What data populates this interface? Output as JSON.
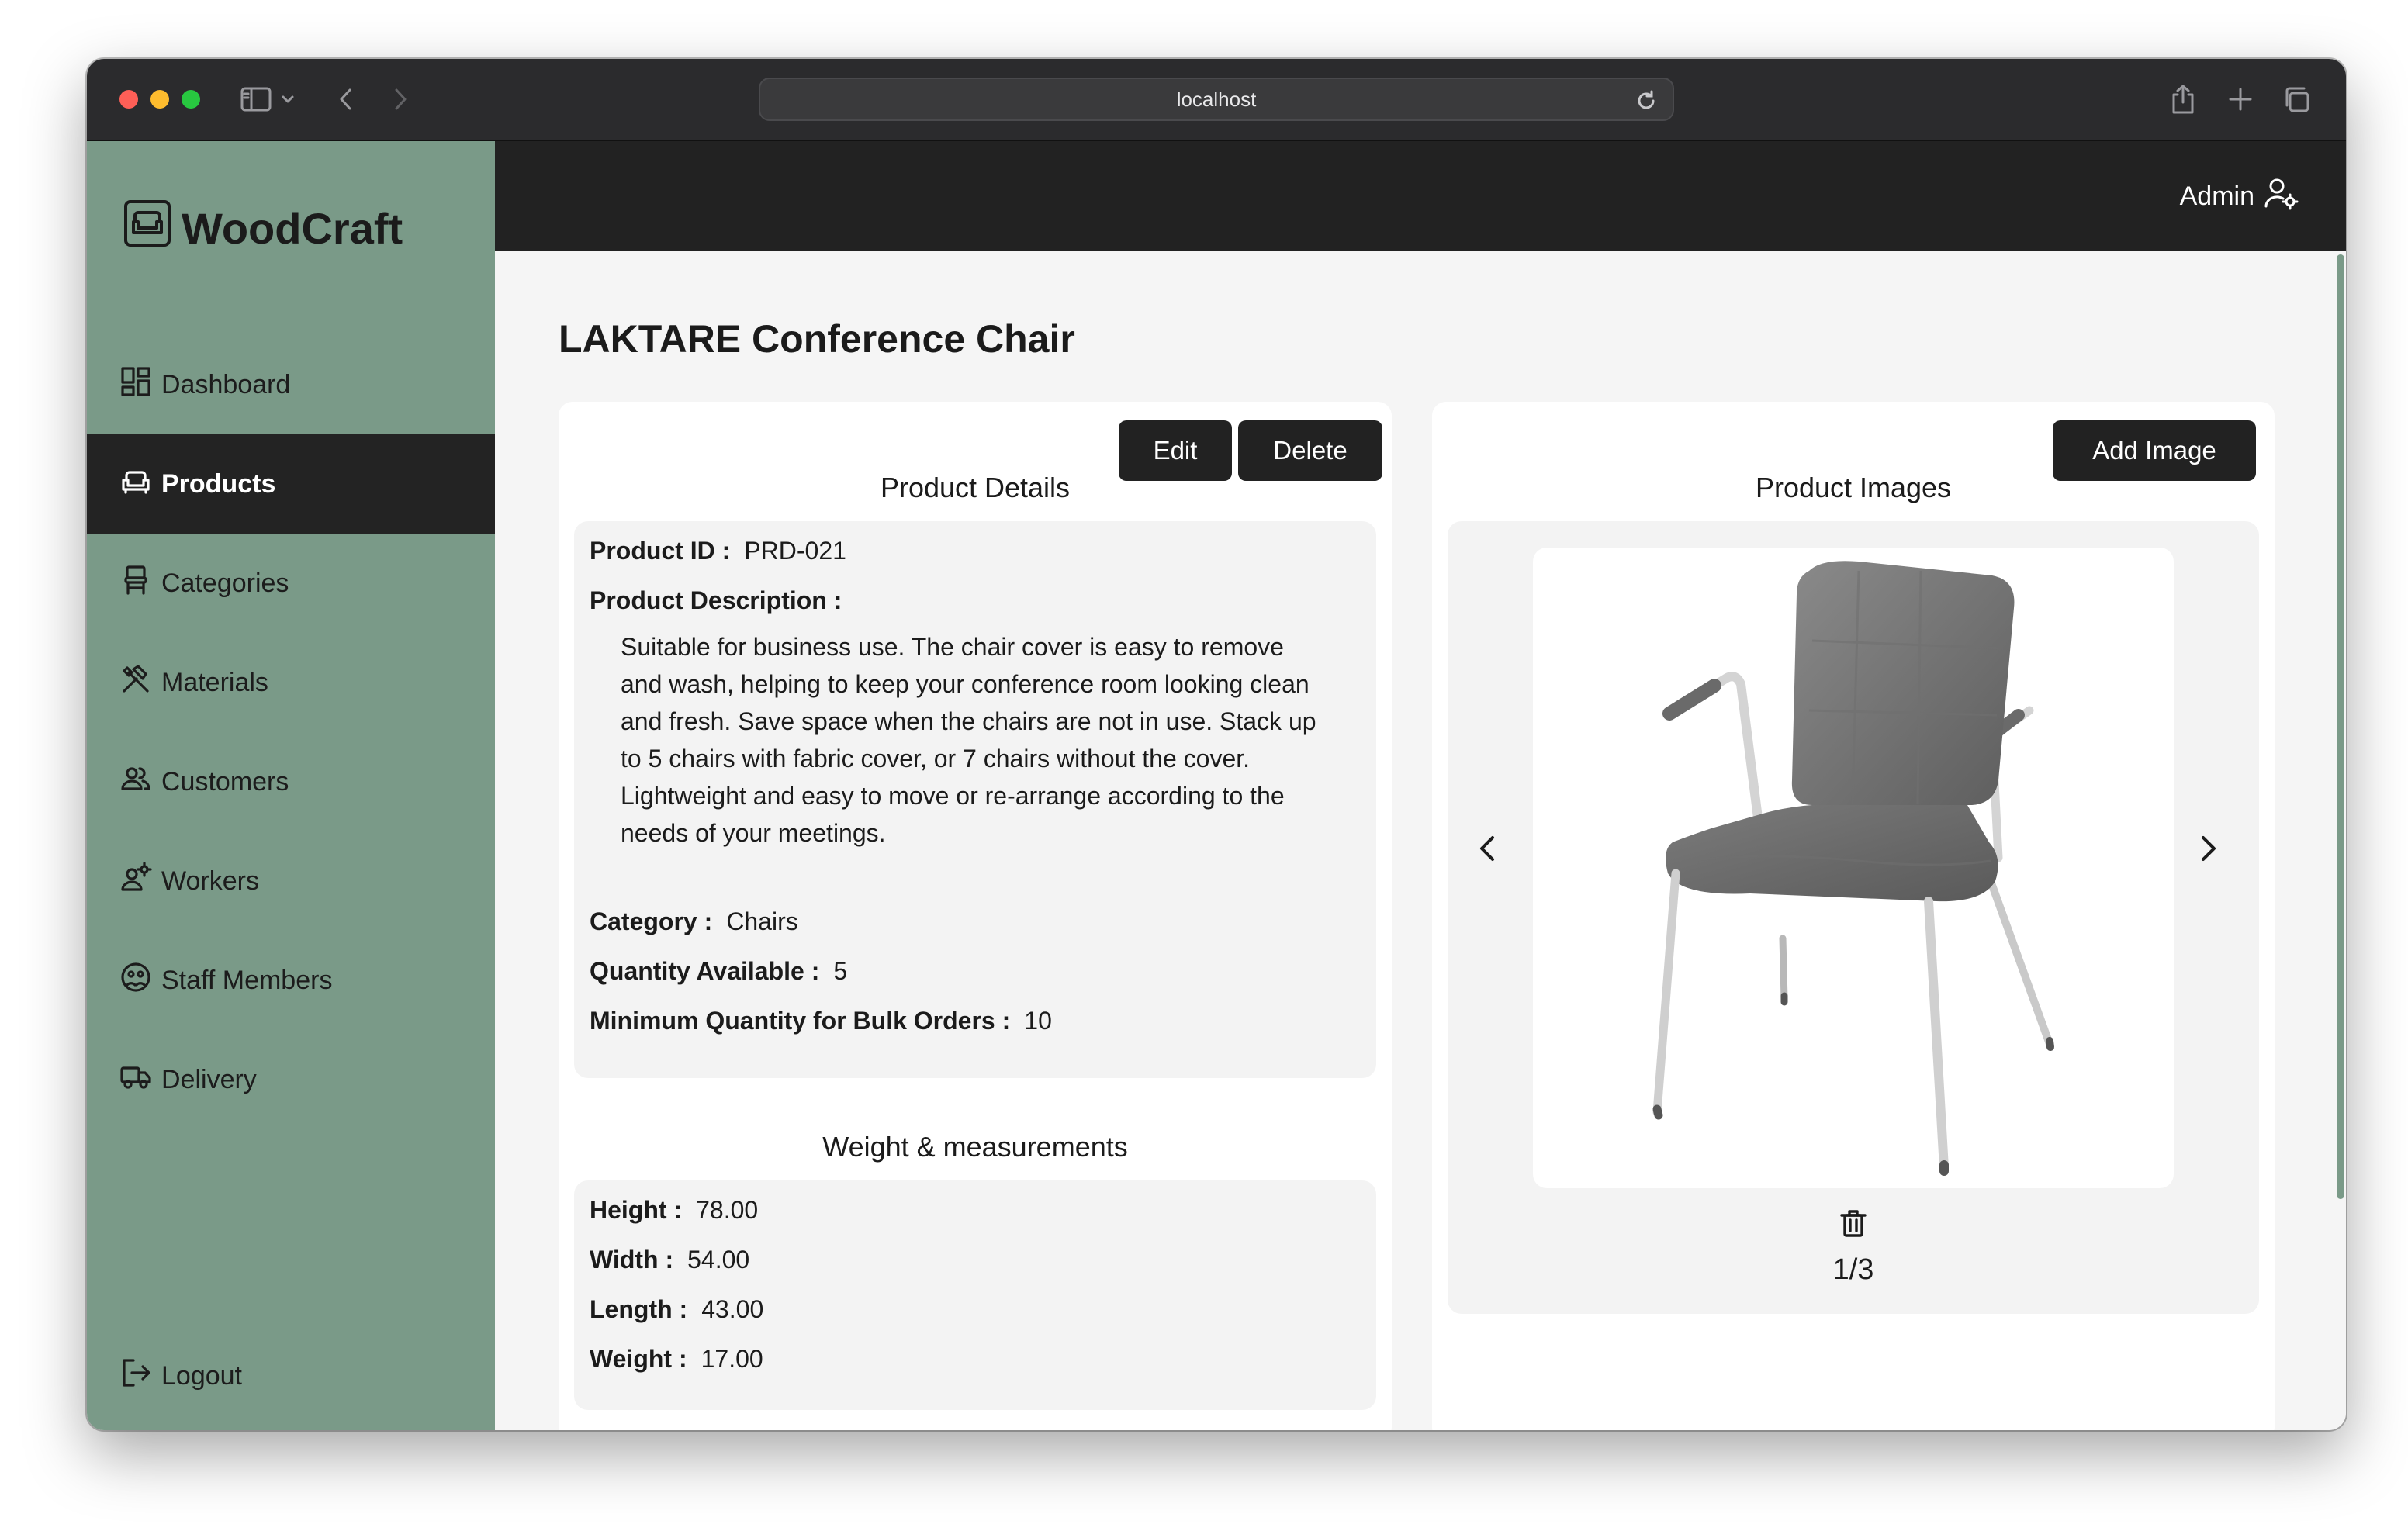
{
  "browser": {
    "url": "localhost"
  },
  "sidebar": {
    "brand": "WoodCraft",
    "items": [
      {
        "label": "Dashboard",
        "icon": "dashboard-icon",
        "active": false
      },
      {
        "label": "Products",
        "icon": "sofa-icon",
        "active": true
      },
      {
        "label": "Categories",
        "icon": "chair-icon",
        "active": false
      },
      {
        "label": "Materials",
        "icon": "tools-icon",
        "active": false
      },
      {
        "label": "Customers",
        "icon": "users-icon",
        "active": false
      },
      {
        "label": "Workers",
        "icon": "worker-icon",
        "active": false
      },
      {
        "label": "Staff Members",
        "icon": "staff-icon",
        "active": false
      },
      {
        "label": "Delivery",
        "icon": "truck-icon",
        "active": false
      }
    ],
    "logout_label": "Logout"
  },
  "topbar": {
    "user_label": "Admin"
  },
  "page": {
    "title": "LAKTARE Conference Chair"
  },
  "details": {
    "section_title": "Product Details",
    "edit_label": "Edit",
    "delete_label": "Delete",
    "product_id_label": "Product ID :",
    "product_id": "PRD-021",
    "description_label": "Product Description :",
    "description": "Suitable for business use. The chair cover is easy to remove and wash, helping to keep your conference room looking clean and fresh. Save space when the chairs are not in use. Stack up to 5 chairs with fabric cover, or 7 chairs without the cover. Lightweight and easy to move or re-arrange according to the needs of your meetings.",
    "category_label": "Category :",
    "category": "Chairs",
    "quantity_label": "Quantity Available :",
    "quantity": "5",
    "min_bulk_label": "Minimum Quantity for Bulk Orders :",
    "min_bulk": "10"
  },
  "measurements": {
    "section_title": "Weight & measurements",
    "height_label": "Height :",
    "height": "78.00",
    "width_label": "Width :",
    "width": "54.00",
    "length_label": "Length :",
    "length": "43.00",
    "weight_label": "Weight :",
    "weight": "17.00"
  },
  "images": {
    "section_title": "Product Images",
    "add_label": "Add Image",
    "counter": "1/3"
  },
  "colors": {
    "sidebar": "#7a9a88",
    "dark": "#222222",
    "page_bg": "#f5f5f5"
  }
}
